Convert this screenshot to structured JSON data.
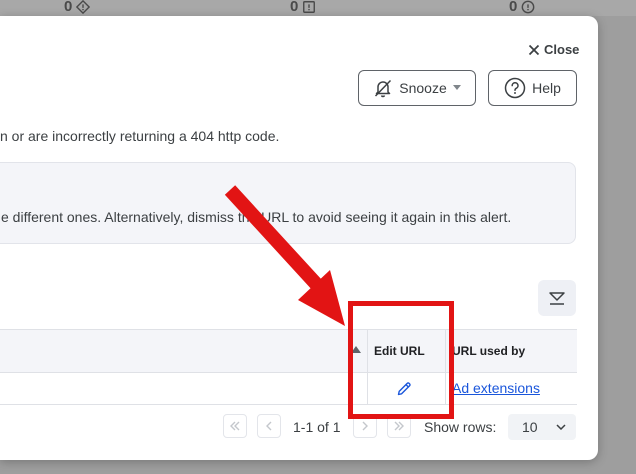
{
  "background_counts": [
    {
      "value": "0",
      "icon": "diamond-alert-icon"
    },
    {
      "value": "0",
      "icon": "square-alert-icon"
    },
    {
      "value": "0",
      "icon": "circle-alert-icon"
    }
  ],
  "modal": {
    "close_label": "Close",
    "snooze_label": "Snooze",
    "help_label": "Help",
    "description": "n or are incorrectly returning a 404 http code.",
    "info_text": "e different ones. Alternatively, dismiss the URL to avoid seeing it again in this alert."
  },
  "table": {
    "columns": [
      "Edit URL",
      "URL used by"
    ],
    "rows": [
      {
        "url_used_by": "Ad extensions"
      }
    ]
  },
  "pagination": {
    "range": "1-1 of 1",
    "rows_label": "Show rows:",
    "rows_value": "10"
  },
  "colors": {
    "annotation": "#e21414",
    "link": "#1a56db"
  }
}
